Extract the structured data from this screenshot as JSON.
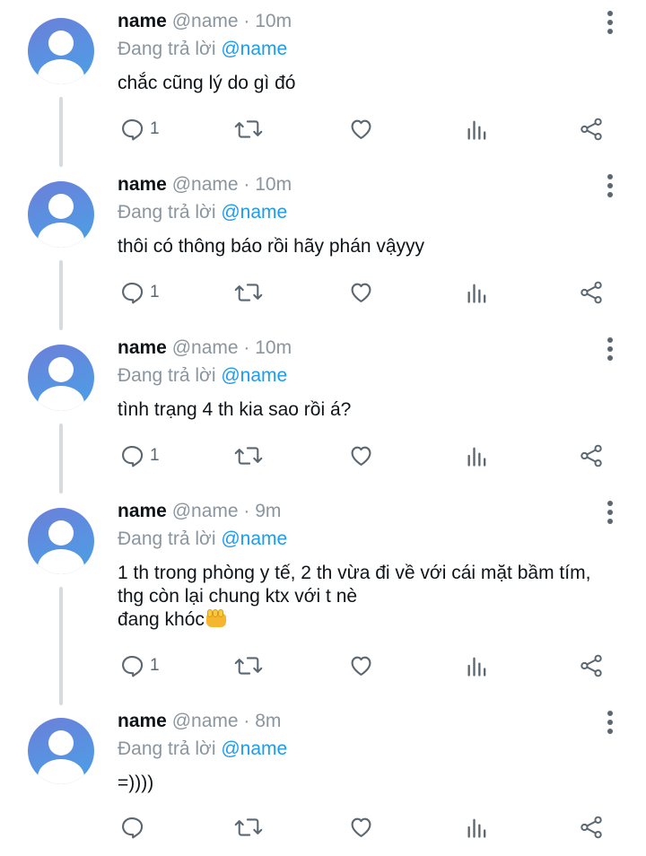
{
  "tweets": [
    {
      "name": "name",
      "meta": " @name · 10m",
      "replying_prefix": "Đang trả lời ",
      "mention": "@name",
      "lines": [
        "chắc cũng lý do gì đó"
      ],
      "reply_count": "1"
    },
    {
      "name": "name",
      "meta": " @name · 10m",
      "replying_prefix": "Đang trả lời ",
      "mention": "@name",
      "lines": [
        "thôi có thông báo rồi hãy phán vậyyy"
      ],
      "reply_count": "1"
    },
    {
      "name": "name",
      "meta": " @name · 10m",
      "replying_prefix": "Đang trả lời ",
      "mention": "@name",
      "lines": [
        "tình trạng 4 th kia sao rồi á?"
      ],
      "reply_count": "1"
    },
    {
      "name": "name",
      "meta": " @name · 9m",
      "replying_prefix": "Đang trả lời ",
      "mention": "@name",
      "lines": [
        "1 th trong phòng y tế, 2 th vừa đi về với cái mặt bầm tím,",
        "thg còn lại chung ktx với t nè",
        "đang khóc"
      ],
      "emoji": "fist-emoji",
      "reply_count": "1"
    },
    {
      "name": "name",
      "meta": " @name · 8m",
      "replying_prefix": "Đang trả lời ",
      "mention": "@name",
      "lines": [
        "=))))"
      ],
      "reply_count": ""
    }
  ],
  "icons": {
    "reply": "reply-icon",
    "retweet": "retweet-icon",
    "like": "heart-icon",
    "views": "analytics-icon",
    "share": "share-icon",
    "more": "more-vertical-icon"
  },
  "colors": {
    "mention": "#1d9bf0",
    "meta": "#8a959e",
    "icon": "#5b6770"
  }
}
